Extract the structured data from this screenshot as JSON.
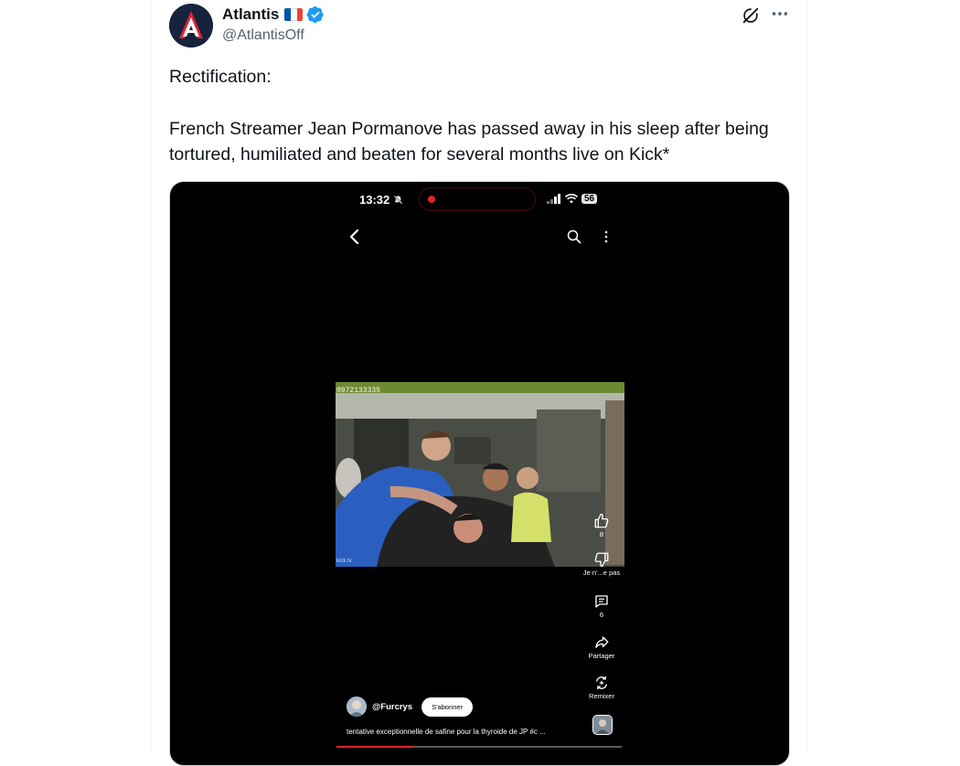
{
  "author": {
    "name": "Atlantis",
    "handle": "@AtlantisOff",
    "flag_colors": [
      "#0055a4",
      "#ffffff",
      "#ef4135"
    ],
    "verified_color": "#1d9bf0",
    "avatar_bg": "#17233d",
    "avatar_accent": "#e0232e",
    "avatar_letter": "A"
  },
  "header_icons": [
    "grok-icon",
    "more-icon"
  ],
  "tweet": {
    "line1": "Rectification:",
    "line2": "French Streamer Jean Pormanove has passed away in his sleep after being tortured, humiliated and beaten for several months live on Kick*"
  },
  "phone": {
    "time": "13:32",
    "battery": "56",
    "recording_color": "#e0232e",
    "video_id": "0972133335",
    "video_watermark": "kick.tv",
    "actions": [
      {
        "icon": "thumbs-up-icon",
        "label": "8"
      },
      {
        "icon": "thumbs-down-icon",
        "label": "Je n'...e pas"
      },
      {
        "icon": "comment-icon",
        "label": "6"
      },
      {
        "icon": "share-icon",
        "label": "Partager"
      },
      {
        "icon": "remix-icon",
        "label": "Remixer"
      }
    ],
    "channel": "@Furcrys",
    "subscribe_label": "S'abonner",
    "caption": "tentative exceptionnelle de safine pour la thyroide de JP #c ...",
    "progress_fraction": 0.27
  }
}
